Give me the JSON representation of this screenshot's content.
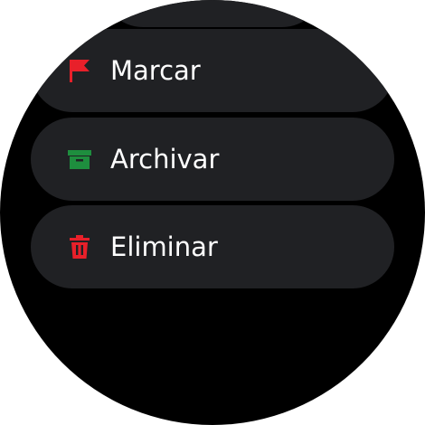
{
  "menu": {
    "items": [
      {
        "label": "Marcar",
        "icon": "flag-icon",
        "icon_color": "#e8202a"
      },
      {
        "label": "Archivar",
        "icon": "archive-icon",
        "icon_color": "#1e8e3e"
      },
      {
        "label": "Eliminar",
        "icon": "trash-icon",
        "icon_color": "#e8202a"
      }
    ]
  },
  "colors": {
    "background": "#000000",
    "chip": "#202124",
    "text": "#ffffff"
  }
}
